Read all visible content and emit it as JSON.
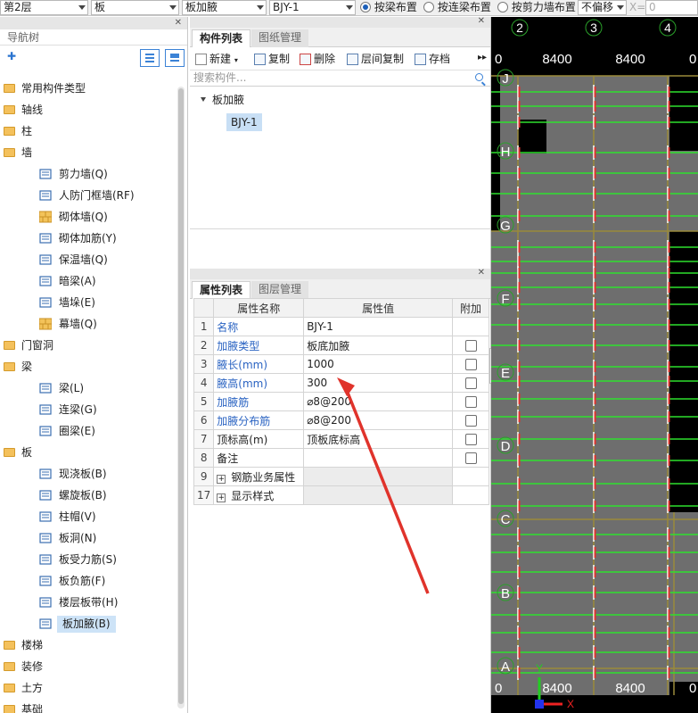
{
  "toolbar": {
    "floor": "第2层",
    "category": "板",
    "type": "板加腋",
    "component": "BJY-1",
    "radio1": "按梁布置",
    "radio2": "按连梁布置",
    "radio3": "按剪力墙布置",
    "offset": "不偏移",
    "x_label": "X=",
    "x_value": "0"
  },
  "nav": {
    "title": "导航树",
    "items": [
      {
        "label": "常用构件类型",
        "level": 0,
        "icon": "folder-icon"
      },
      {
        "label": "轴线",
        "level": 0,
        "icon": "folder-icon"
      },
      {
        "label": "柱",
        "level": 0,
        "icon": "folder-icon"
      },
      {
        "label": "墙",
        "level": 0,
        "icon": "folder-icon"
      },
      {
        "label": "剪力墙(Q)",
        "level": 1,
        "icon": "shear-wall-icon"
      },
      {
        "label": "人防门框墙(RF)",
        "level": 1,
        "icon": "door-frame-wall-icon"
      },
      {
        "label": "砌体墙(Q)",
        "level": 1,
        "icon": "brick-wall-icon"
      },
      {
        "label": "砌体加筋(Y)",
        "level": 1,
        "icon": "brick-rebar-icon"
      },
      {
        "label": "保温墙(Q)",
        "level": 1,
        "icon": "insulation-wall-icon"
      },
      {
        "label": "暗梁(A)",
        "level": 1,
        "icon": "hidden-beam-icon"
      },
      {
        "label": "墙垛(E)",
        "level": 1,
        "icon": "wall-pier-icon"
      },
      {
        "label": "幕墙(Q)",
        "level": 1,
        "icon": "curtain-wall-icon"
      },
      {
        "label": "门窗洞",
        "level": 0,
        "icon": "folder-icon"
      },
      {
        "label": "梁",
        "level": 0,
        "icon": "folder-icon"
      },
      {
        "label": "梁(L)",
        "level": 1,
        "icon": "beam-icon"
      },
      {
        "label": "连梁(G)",
        "level": 1,
        "icon": "coupling-beam-icon"
      },
      {
        "label": "圈梁(E)",
        "level": 1,
        "icon": "ring-beam-icon"
      },
      {
        "label": "板",
        "level": 0,
        "icon": "folder-icon"
      },
      {
        "label": "现浇板(B)",
        "level": 1,
        "icon": "cast-slab-icon"
      },
      {
        "label": "螺旋板(B)",
        "level": 1,
        "icon": "spiral-slab-icon"
      },
      {
        "label": "柱帽(V)",
        "level": 1,
        "icon": "column-cap-icon"
      },
      {
        "label": "板洞(N)",
        "level": 1,
        "icon": "slab-hole-icon"
      },
      {
        "label": "板受力筋(S)",
        "level": 1,
        "icon": "slab-rebar-icon"
      },
      {
        "label": "板负筋(F)",
        "level": 1,
        "icon": "negative-rebar-icon"
      },
      {
        "label": "楼层板带(H)",
        "level": 1,
        "icon": "floor-strip-icon"
      },
      {
        "label": "板加腋(B)",
        "level": 1,
        "icon": "slab-haunch-icon",
        "selected": true
      },
      {
        "label": "楼梯",
        "level": 0,
        "icon": "folder-icon"
      },
      {
        "label": "装修",
        "level": 0,
        "icon": "folder-icon"
      },
      {
        "label": "土方",
        "level": 0,
        "icon": "folder-icon"
      },
      {
        "label": "基础",
        "level": 0,
        "icon": "folder-icon"
      }
    ]
  },
  "component_panel": {
    "tab_active": "构件列表",
    "tab_inactive": "图纸管理",
    "buttons": {
      "new": "新建",
      "copy": "复制",
      "delete": "删除",
      "floor_copy": "层间复制",
      "save": "存档"
    },
    "search_placeholder": "搜索构件...",
    "tree_parent": "板加腋",
    "tree_child": "BJY-1"
  },
  "property_panel": {
    "tab_active": "属性列表",
    "tab_inactive": "图层管理",
    "headers": {
      "name": "属性名称",
      "value": "属性值",
      "extra": "附加"
    },
    "rows": [
      {
        "no": "1",
        "name": "名称",
        "value": "BJY-1",
        "blue": true,
        "checkbox": false
      },
      {
        "no": "2",
        "name": "加腋类型",
        "value": "板底加腋",
        "blue": true,
        "checkbox": true
      },
      {
        "no": "3",
        "name": "腋长(mm)",
        "value": "1000",
        "blue": true,
        "checkbox": true
      },
      {
        "no": "4",
        "name": "腋高(mm)",
        "value": "300",
        "blue": true,
        "checkbox": true
      },
      {
        "no": "5",
        "name": "加腋筋",
        "value": "⌀8@200",
        "blue": true,
        "checkbox": true
      },
      {
        "no": "6",
        "name": "加腋分布筋",
        "value": "⌀8@200",
        "blue": true,
        "checkbox": true
      },
      {
        "no": "7",
        "name": "顶标高(m)",
        "value": "顶板底标高",
        "blue": false,
        "checkbox": true
      },
      {
        "no": "8",
        "name": "备注",
        "value": "",
        "blue": false,
        "checkbox": true
      },
      {
        "no": "9",
        "name": "钢筋业务属性",
        "value": "",
        "blue": false,
        "checkbox": false,
        "group": true
      },
      {
        "no": "17",
        "name": "显示样式",
        "value": "",
        "blue": false,
        "checkbox": false,
        "group": true
      }
    ]
  },
  "canvas": {
    "axes_top": [
      "2",
      "3",
      "4"
    ],
    "dims_top": [
      "8400",
      "8400"
    ],
    "axes_left": [
      "J",
      "H",
      "G",
      "F",
      "E",
      "D",
      "C",
      "B",
      "A"
    ],
    "dims_bottom": [
      "8400",
      "8400"
    ],
    "coord_x": "X",
    "coord_y": "Y",
    "edge_zero": "0",
    "colors": {
      "slab": "#6e6e6e",
      "rebar": "#2ee02e",
      "beam": "#9a8a3a",
      "axis_circle": "#2aa02a",
      "red_mark": "#e0332b"
    }
  }
}
